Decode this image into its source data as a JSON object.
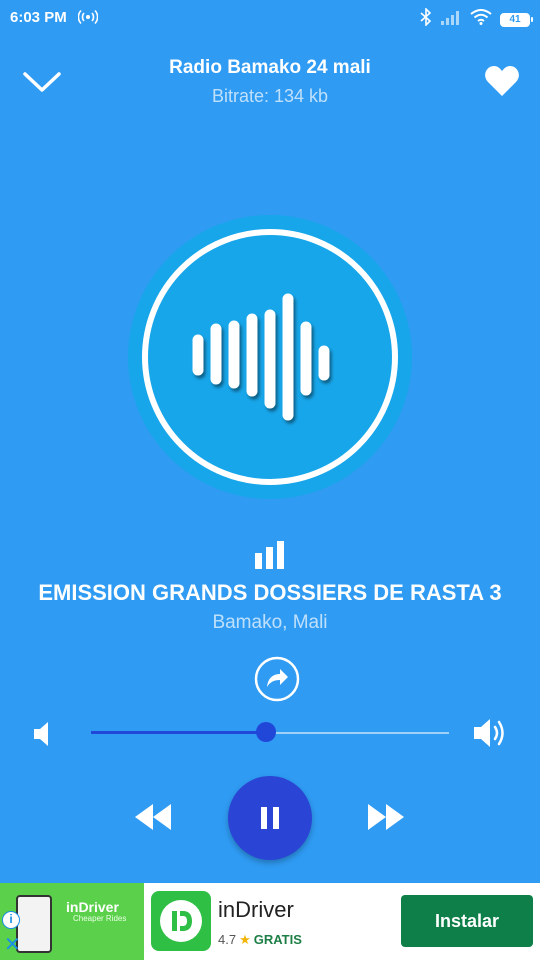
{
  "status_bar": {
    "time": "6:03 PM",
    "battery": "41",
    "battery_level": 0.41
  },
  "header": {
    "title": "Radio Bamako 24 mali",
    "subtitle": "Bitrate: 134 kb",
    "back_icon": "chevron-down-icon",
    "favorite_icon": "heart-icon"
  },
  "station_art": {
    "icon": "sound-wave-icon"
  },
  "now_playing": {
    "equalizer_icon": "equalizer-icon",
    "title": "EMISSION GRANDS DOSSIERS DE RASTA 3",
    "location": "Bamako, Mali",
    "share_icon": "share-icon"
  },
  "volume": {
    "level": 0.49,
    "low_icon": "volume-low-icon",
    "high_icon": "volume-high-icon"
  },
  "controls": {
    "rewind_icon": "rewind-icon",
    "pause_icon": "pause-icon",
    "forward_icon": "fast-forward-icon"
  },
  "ad": {
    "banner_title": "inDriver",
    "banner_subtitle": "Cheaper Rides",
    "app_name": "inDriver",
    "rating": "4.7",
    "price": "GRATIS",
    "install_label": "Instalar"
  },
  "colors": {
    "background": "#2f9bf3",
    "accent": "#2a44d6",
    "art_circle": "#17a6ea",
    "install_button": "#0f7f4a"
  }
}
